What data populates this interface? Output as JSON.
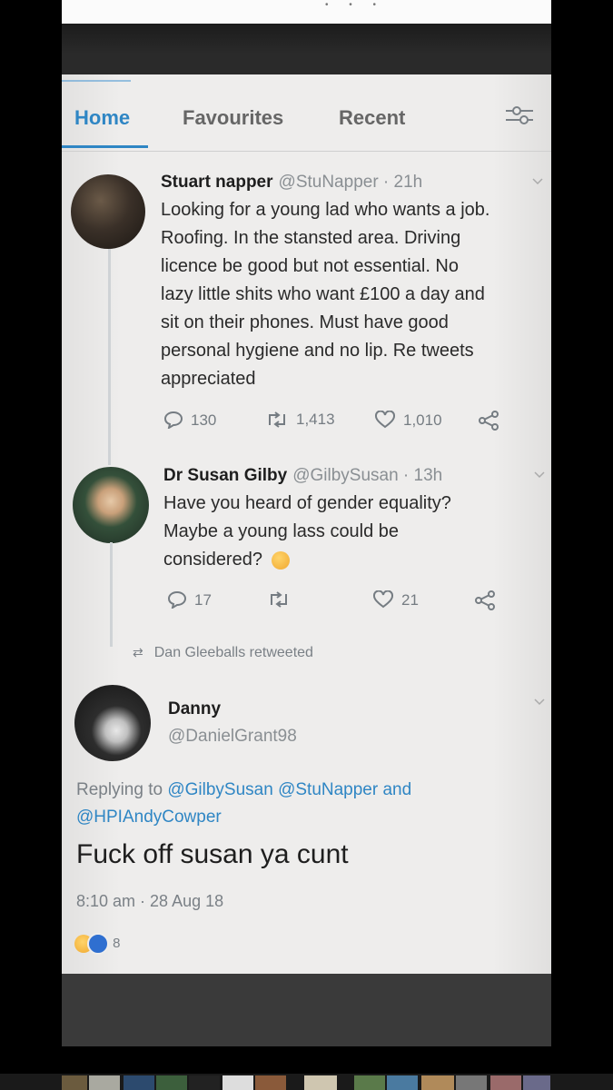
{
  "tabs": {
    "home": "Home",
    "favourites": "Favourites",
    "recent": "Recent"
  },
  "icons": {
    "filter": "sliders-icon",
    "chevron": "chevron-down-icon",
    "reply": "reply-icon",
    "retweet": "retweet-icon",
    "like": "heart-icon",
    "share": "share-icon"
  },
  "tweets": [
    {
      "name": "Stuart napper",
      "handle": "@StuNapper · 21h",
      "lines": [
        "Looking for a young lad who wants a job.",
        "Roofing. In the  stansted area. Driving",
        "licence be good but not essential. No",
        "lazy little shits who want £100 a day and",
        "sit on their phones. Must have good",
        "personal hygiene and no lip. Re tweets",
        "appreciated"
      ],
      "replies": "130",
      "retweets": "1,413",
      "likes": "1,010"
    },
    {
      "name": "Dr Susan Gilby",
      "handle": "@GilbySusan · 13h",
      "lines": [
        "Have you heard of gender equality?",
        "Maybe a young lass could be",
        "considered?"
      ],
      "replies": "17",
      "retweets": "",
      "likes": "21"
    }
  ],
  "retweeted_by": "Dan Gleeballs retweeted",
  "reply_tweet": {
    "name": "Danny",
    "handle": "@DanielGrant98",
    "replying_prefix": "Replying to",
    "mention1": "@GilbySusan",
    "mention2": "@StuNapper",
    "and_word": "and",
    "mention3": "@HPIAndyCowper",
    "text": "Fuck off susan ya cunt",
    "timestamp": "8:10 am · 28 Aug 18",
    "reaction_count": "8"
  },
  "colors": {
    "accent": "#2f86c4",
    "screen_bg": "#eeedec"
  }
}
